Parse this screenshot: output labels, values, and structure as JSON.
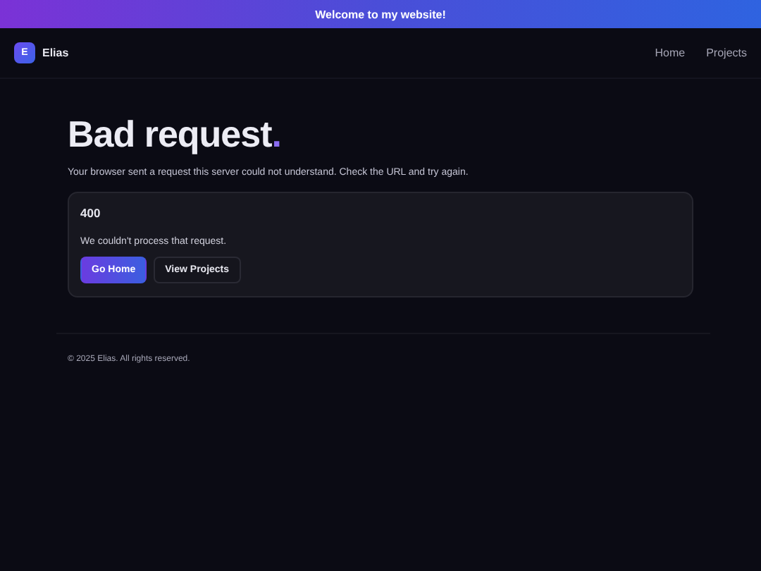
{
  "banner": {
    "text": "Welcome to my website!"
  },
  "nav": {
    "logo_letter": "E",
    "brand": "Elias",
    "links": [
      "Home",
      "Projects"
    ]
  },
  "hero": {
    "title": "Bad request",
    "title_accent": ".",
    "subtitle": "Your browser sent a request this server could not understand. Check the URL and try again."
  },
  "card": {
    "code": "400",
    "message": "We couldn't process that request.",
    "buttons": [
      {
        "label": "Go Home",
        "kind": "primary"
      },
      {
        "label": "View Projects",
        "kind": "secondary"
      }
    ]
  },
  "footer": {
    "text": "© 2025 Elias. All rights reserved."
  }
}
